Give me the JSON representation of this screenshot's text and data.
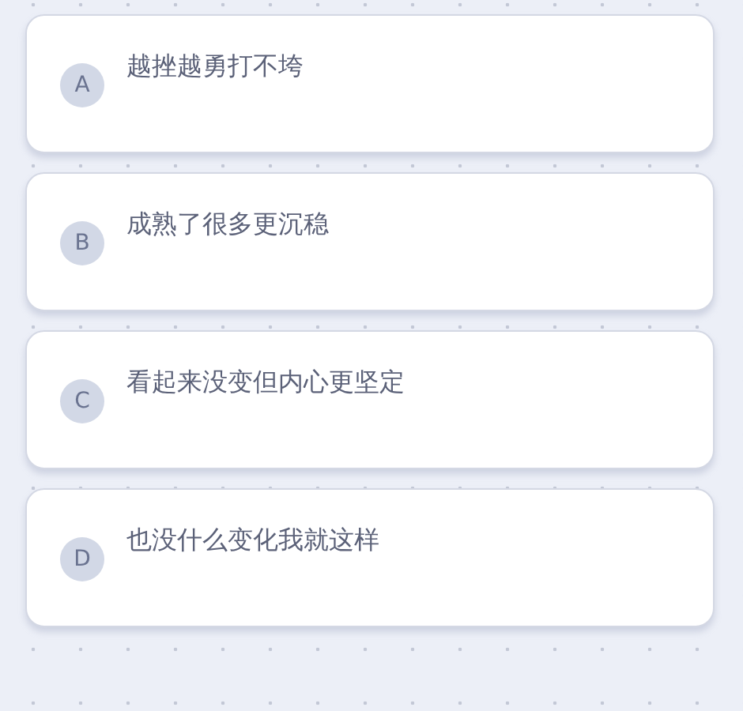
{
  "options": [
    {
      "letter": "A",
      "text": "越挫越勇打不垮"
    },
    {
      "letter": "B",
      "text": "成熟了很多更沉稳"
    },
    {
      "letter": "C",
      "text": "看起来没变但内心更坚定"
    },
    {
      "letter": "D",
      "text": "也没什么变化我就这样"
    }
  ]
}
